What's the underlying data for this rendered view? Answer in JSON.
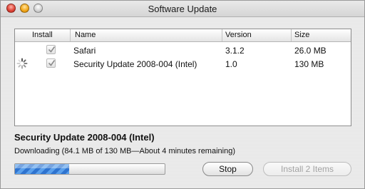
{
  "window": {
    "title": "Software Update"
  },
  "table": {
    "headers": {
      "install": "Install",
      "name": "Name",
      "version": "Version",
      "size": "Size"
    },
    "rows": [
      {
        "name": "Safari",
        "version": "3.1.2",
        "size": "26.0 MB",
        "checked": true
      },
      {
        "name": "Security Update 2008-004 (Intel)",
        "version": "1.0",
        "size": "130 MB",
        "checked": true
      }
    ]
  },
  "status": {
    "title": "Security Update 2008-004 (Intel)",
    "detail": "Downloading (84.1 MB of 130 MB—About 4 minutes remaining)",
    "progress_fraction": 0.36
  },
  "buttons": {
    "stop": "Stop",
    "install": "Install 2 Items"
  },
  "icons": {
    "checkbox": "checkmark-icon",
    "activity": "spinner-icon"
  }
}
